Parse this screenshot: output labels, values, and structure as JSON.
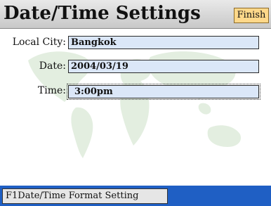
{
  "header": {
    "title": "Date/Time Settings",
    "finish_label": "Finish"
  },
  "form": {
    "local_city": {
      "label": "Local City:",
      "value": "Bangkok"
    },
    "date": {
      "label": "Date:",
      "value": "2004/03/19"
    },
    "time": {
      "label": "Time:",
      "value": "3:00pm"
    }
  },
  "footer": {
    "format_setting_label": "F1Date/Time Format Setting"
  },
  "colors": {
    "field_bg": "#dbe7f8",
    "finish_bg": "#ffd88a",
    "statusbar_bg": "#1f5fc4",
    "map": "#e3eee0"
  },
  "icons": {
    "background": "world-map-icon"
  }
}
